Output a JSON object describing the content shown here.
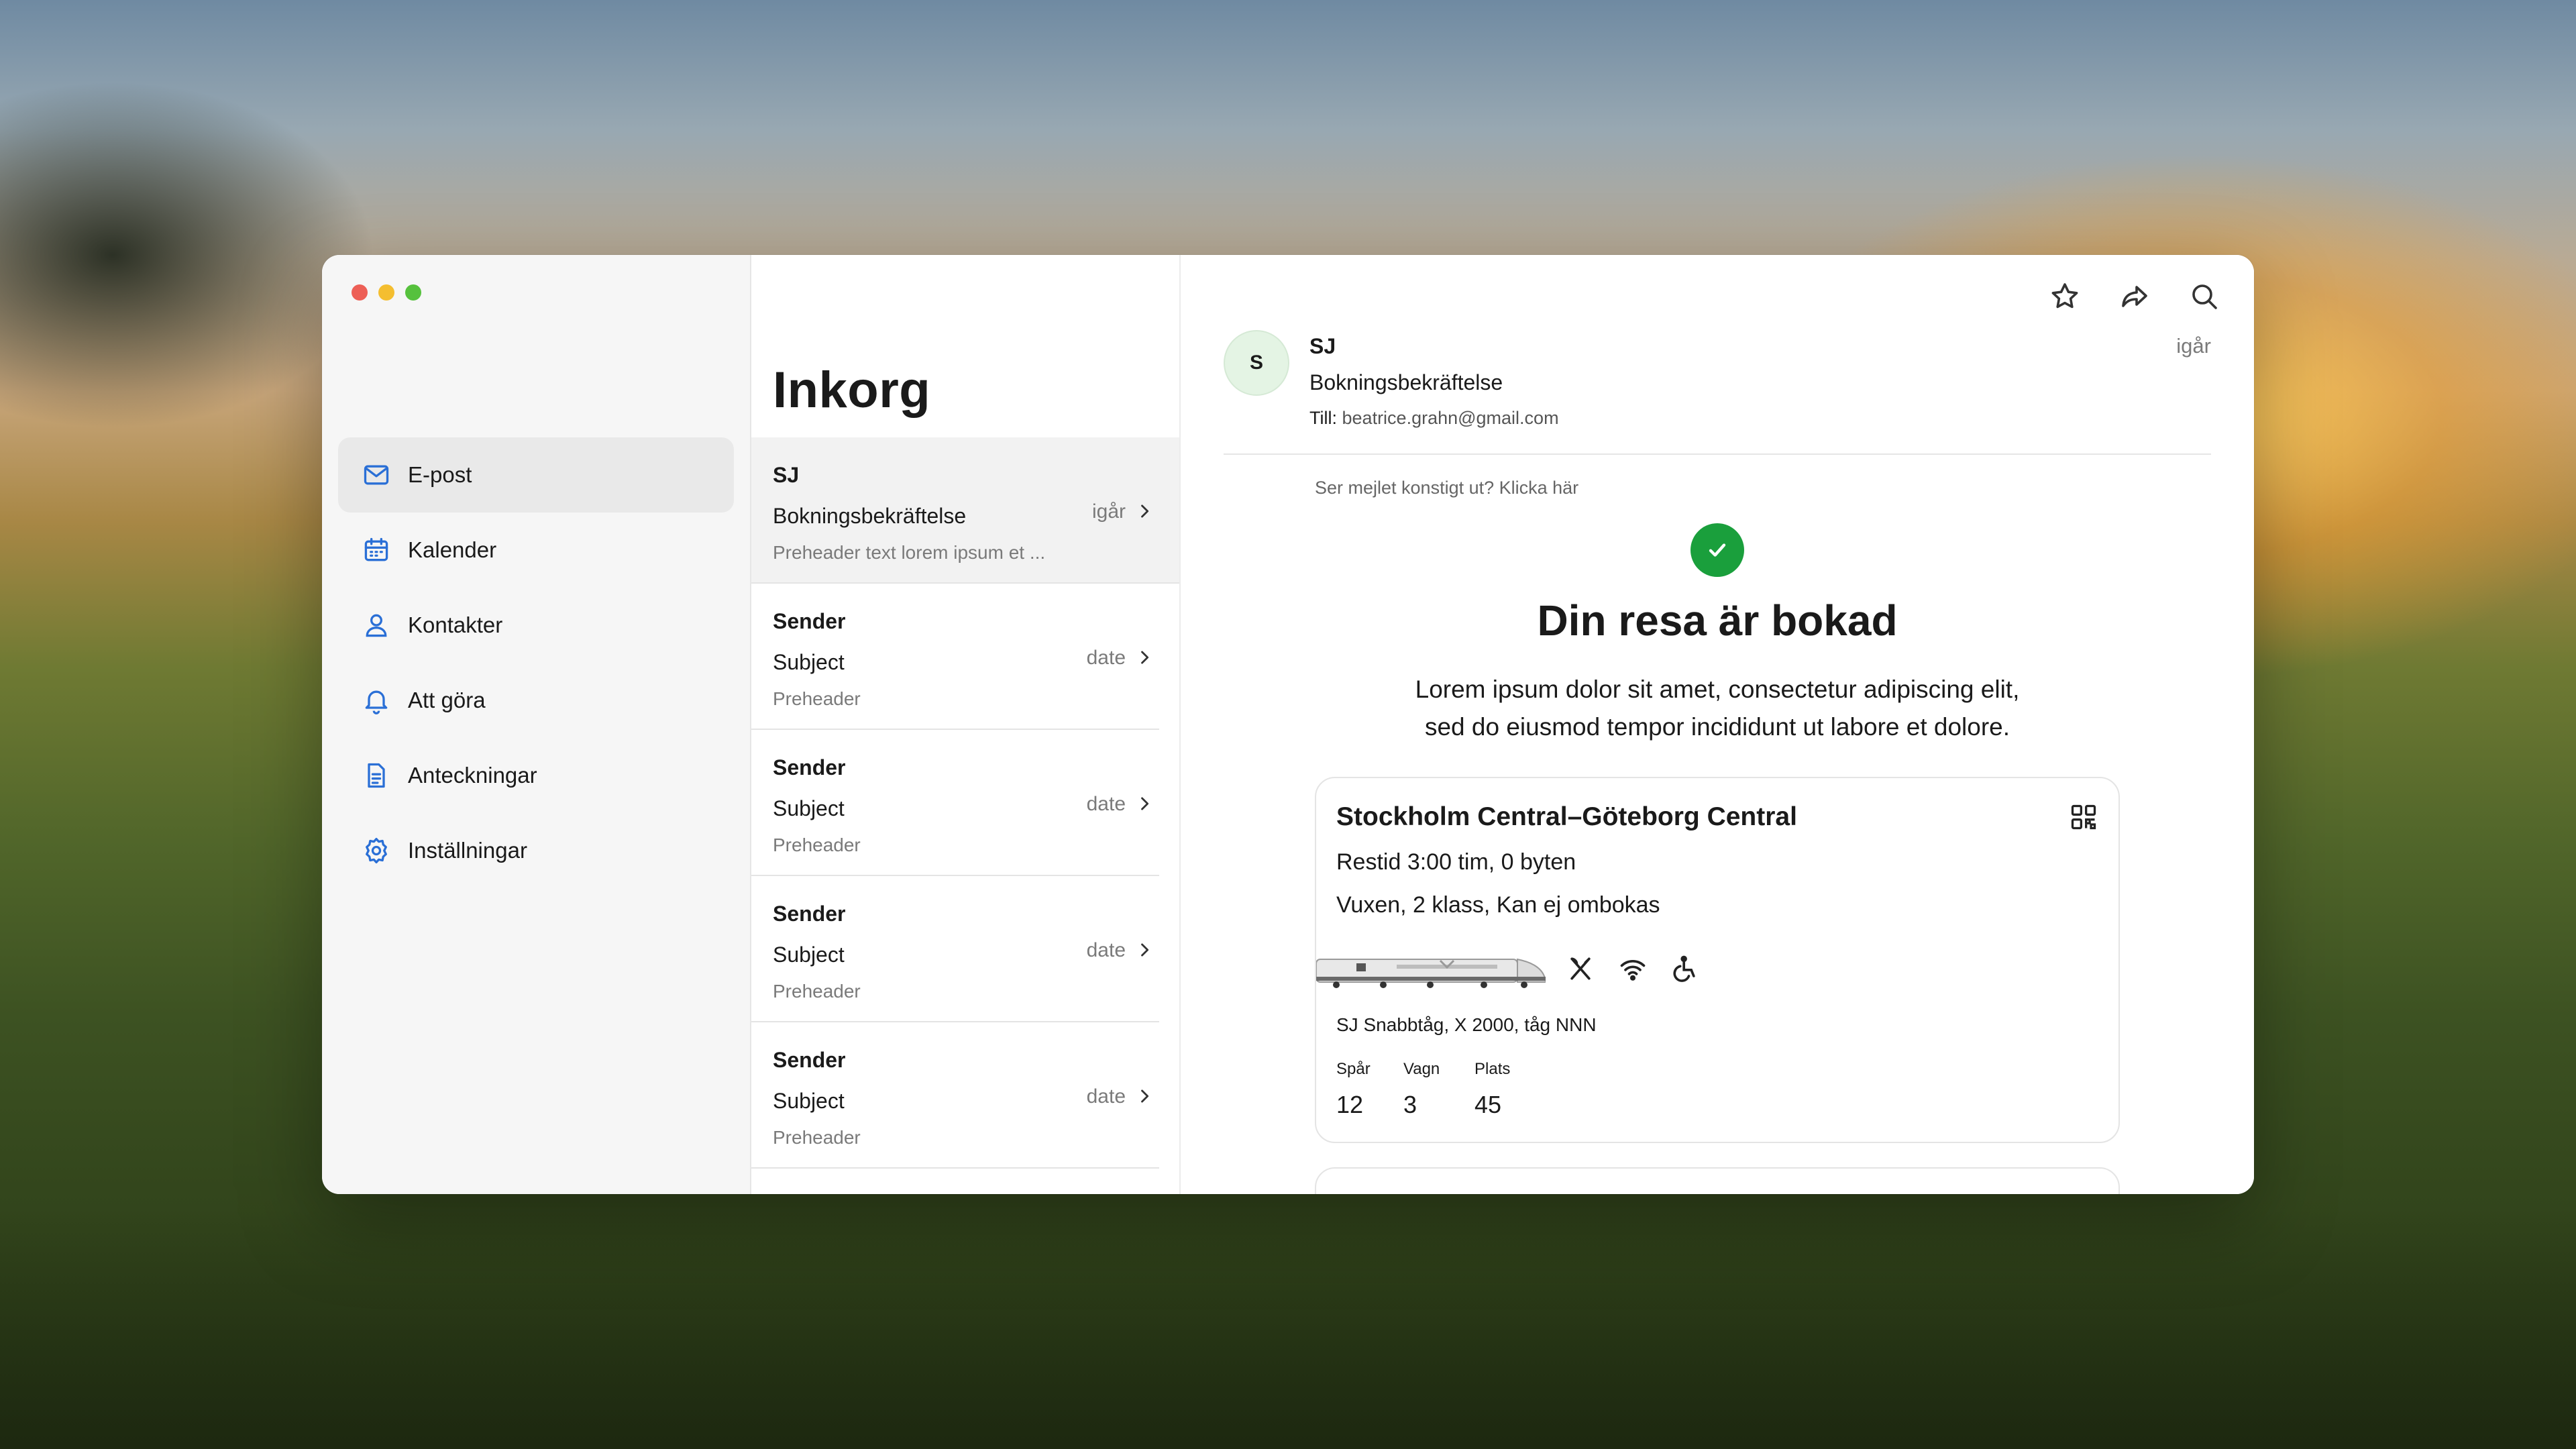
{
  "sidebar": {
    "items": [
      {
        "label": "E-post",
        "icon": "mail-icon",
        "active": true
      },
      {
        "label": "Kalender",
        "icon": "calendar-icon"
      },
      {
        "label": "Kontakter",
        "icon": "person-icon"
      },
      {
        "label": "Att göra",
        "icon": "bell-icon"
      },
      {
        "label": "Anteckningar",
        "icon": "document-icon"
      },
      {
        "label": "Inställningar",
        "icon": "gear-icon"
      }
    ]
  },
  "list": {
    "title": "Inkorg",
    "rows": [
      {
        "sender": "SJ",
        "subject": "Bokningsbekräftelse",
        "preheader": "Preheader text lorem ipsum et ...",
        "date": "igår"
      },
      {
        "sender": "Sender",
        "subject": "Subject",
        "preheader": "Preheader",
        "date": "date"
      },
      {
        "sender": "Sender",
        "subject": "Subject",
        "preheader": "Preheader",
        "date": "date"
      },
      {
        "sender": "Sender",
        "subject": "Subject",
        "preheader": "Preheader",
        "date": "date"
      },
      {
        "sender": "Sender",
        "subject": "Subject",
        "preheader": "Preheader",
        "date": "date"
      }
    ]
  },
  "reader": {
    "toolbar": [
      "star-icon",
      "share-icon",
      "search-icon"
    ],
    "avatar_initial": "S",
    "sender": "SJ",
    "subject": "Bokningsbekräftelse",
    "to_label": "Till:",
    "to_address": "beatrice.grahn@gmail.com",
    "date": "igår",
    "weird_link": "Ser mejlet konstigt ut? Klicka här",
    "headline": "Din resa är bokad",
    "lead_line1": "Lorem ipsum dolor sit amet, consectetur adipiscing elit,",
    "lead_line2": "sed do eiusmod tempor incididunt ut labore et dolore.",
    "ticket": {
      "route": "Stockholm Central–Göteborg Central",
      "duration": "Restid 3:00 tim, 0 byten",
      "passenger": "Vuxen, 2 klass, Kan ej ombokas",
      "amenities": [
        "restaurant-icon",
        "wifi-icon",
        "accessibility-icon"
      ],
      "train_info": "SJ Snabbtåg, X 2000, tåg NNN",
      "seat": [
        {
          "label": "Spår",
          "value": "12"
        },
        {
          "label": "Vagn",
          "value": "3"
        },
        {
          "label": "Plats",
          "value": "45"
        }
      ]
    }
  },
  "colors": {
    "accent": "#2a6fd6",
    "success": "#1a9f3c",
    "avatar_bg": "#e4f4e4",
    "close": "#ed5f56",
    "minimize": "#f4be30",
    "zoom": "#56c13d"
  }
}
